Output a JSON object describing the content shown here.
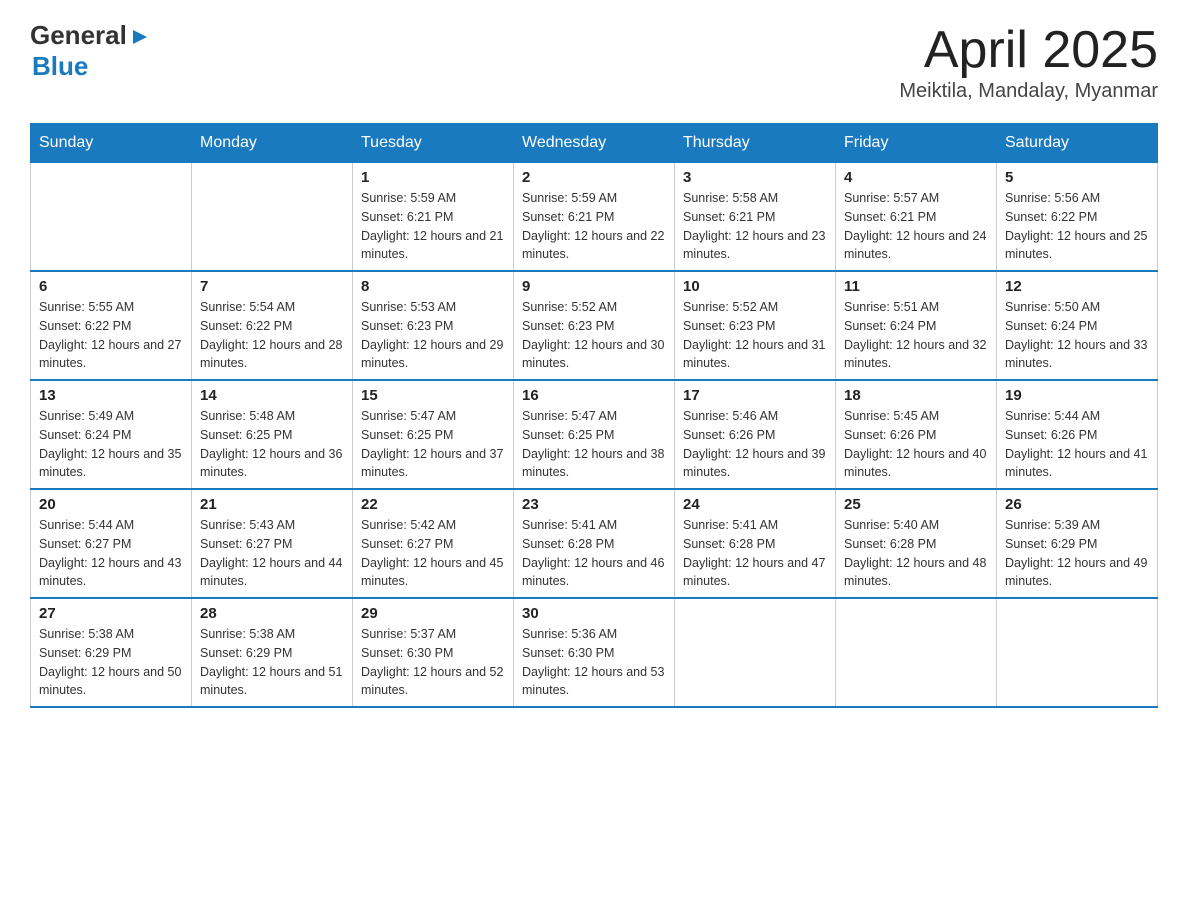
{
  "header": {
    "logo": {
      "text_general": "General",
      "text_blue": "Blue",
      "triangle": "▶"
    },
    "title": "April 2025",
    "subtitle": "Meiktila, Mandalay, Myanmar"
  },
  "calendar": {
    "headers": [
      "Sunday",
      "Monday",
      "Tuesday",
      "Wednesday",
      "Thursday",
      "Friday",
      "Saturday"
    ],
    "weeks": [
      [
        {
          "day": "",
          "sunrise": "",
          "sunset": "",
          "daylight": ""
        },
        {
          "day": "",
          "sunrise": "",
          "sunset": "",
          "daylight": ""
        },
        {
          "day": "1",
          "sunrise": "Sunrise: 5:59 AM",
          "sunset": "Sunset: 6:21 PM",
          "daylight": "Daylight: 12 hours and 21 minutes."
        },
        {
          "day": "2",
          "sunrise": "Sunrise: 5:59 AM",
          "sunset": "Sunset: 6:21 PM",
          "daylight": "Daylight: 12 hours and 22 minutes."
        },
        {
          "day": "3",
          "sunrise": "Sunrise: 5:58 AM",
          "sunset": "Sunset: 6:21 PM",
          "daylight": "Daylight: 12 hours and 23 minutes."
        },
        {
          "day": "4",
          "sunrise": "Sunrise: 5:57 AM",
          "sunset": "Sunset: 6:21 PM",
          "daylight": "Daylight: 12 hours and 24 minutes."
        },
        {
          "day": "5",
          "sunrise": "Sunrise: 5:56 AM",
          "sunset": "Sunset: 6:22 PM",
          "daylight": "Daylight: 12 hours and 25 minutes."
        }
      ],
      [
        {
          "day": "6",
          "sunrise": "Sunrise: 5:55 AM",
          "sunset": "Sunset: 6:22 PM",
          "daylight": "Daylight: 12 hours and 27 minutes."
        },
        {
          "day": "7",
          "sunrise": "Sunrise: 5:54 AM",
          "sunset": "Sunset: 6:22 PM",
          "daylight": "Daylight: 12 hours and 28 minutes."
        },
        {
          "day": "8",
          "sunrise": "Sunrise: 5:53 AM",
          "sunset": "Sunset: 6:23 PM",
          "daylight": "Daylight: 12 hours and 29 minutes."
        },
        {
          "day": "9",
          "sunrise": "Sunrise: 5:52 AM",
          "sunset": "Sunset: 6:23 PM",
          "daylight": "Daylight: 12 hours and 30 minutes."
        },
        {
          "day": "10",
          "sunrise": "Sunrise: 5:52 AM",
          "sunset": "Sunset: 6:23 PM",
          "daylight": "Daylight: 12 hours and 31 minutes."
        },
        {
          "day": "11",
          "sunrise": "Sunrise: 5:51 AM",
          "sunset": "Sunset: 6:24 PM",
          "daylight": "Daylight: 12 hours and 32 minutes."
        },
        {
          "day": "12",
          "sunrise": "Sunrise: 5:50 AM",
          "sunset": "Sunset: 6:24 PM",
          "daylight": "Daylight: 12 hours and 33 minutes."
        }
      ],
      [
        {
          "day": "13",
          "sunrise": "Sunrise: 5:49 AM",
          "sunset": "Sunset: 6:24 PM",
          "daylight": "Daylight: 12 hours and 35 minutes."
        },
        {
          "day": "14",
          "sunrise": "Sunrise: 5:48 AM",
          "sunset": "Sunset: 6:25 PM",
          "daylight": "Daylight: 12 hours and 36 minutes."
        },
        {
          "day": "15",
          "sunrise": "Sunrise: 5:47 AM",
          "sunset": "Sunset: 6:25 PM",
          "daylight": "Daylight: 12 hours and 37 minutes."
        },
        {
          "day": "16",
          "sunrise": "Sunrise: 5:47 AM",
          "sunset": "Sunset: 6:25 PM",
          "daylight": "Daylight: 12 hours and 38 minutes."
        },
        {
          "day": "17",
          "sunrise": "Sunrise: 5:46 AM",
          "sunset": "Sunset: 6:26 PM",
          "daylight": "Daylight: 12 hours and 39 minutes."
        },
        {
          "day": "18",
          "sunrise": "Sunrise: 5:45 AM",
          "sunset": "Sunset: 6:26 PM",
          "daylight": "Daylight: 12 hours and 40 minutes."
        },
        {
          "day": "19",
          "sunrise": "Sunrise: 5:44 AM",
          "sunset": "Sunset: 6:26 PM",
          "daylight": "Daylight: 12 hours and 41 minutes."
        }
      ],
      [
        {
          "day": "20",
          "sunrise": "Sunrise: 5:44 AM",
          "sunset": "Sunset: 6:27 PM",
          "daylight": "Daylight: 12 hours and 43 minutes."
        },
        {
          "day": "21",
          "sunrise": "Sunrise: 5:43 AM",
          "sunset": "Sunset: 6:27 PM",
          "daylight": "Daylight: 12 hours and 44 minutes."
        },
        {
          "day": "22",
          "sunrise": "Sunrise: 5:42 AM",
          "sunset": "Sunset: 6:27 PM",
          "daylight": "Daylight: 12 hours and 45 minutes."
        },
        {
          "day": "23",
          "sunrise": "Sunrise: 5:41 AM",
          "sunset": "Sunset: 6:28 PM",
          "daylight": "Daylight: 12 hours and 46 minutes."
        },
        {
          "day": "24",
          "sunrise": "Sunrise: 5:41 AM",
          "sunset": "Sunset: 6:28 PM",
          "daylight": "Daylight: 12 hours and 47 minutes."
        },
        {
          "day": "25",
          "sunrise": "Sunrise: 5:40 AM",
          "sunset": "Sunset: 6:28 PM",
          "daylight": "Daylight: 12 hours and 48 minutes."
        },
        {
          "day": "26",
          "sunrise": "Sunrise: 5:39 AM",
          "sunset": "Sunset: 6:29 PM",
          "daylight": "Daylight: 12 hours and 49 minutes."
        }
      ],
      [
        {
          "day": "27",
          "sunrise": "Sunrise: 5:38 AM",
          "sunset": "Sunset: 6:29 PM",
          "daylight": "Daylight: 12 hours and 50 minutes."
        },
        {
          "day": "28",
          "sunrise": "Sunrise: 5:38 AM",
          "sunset": "Sunset: 6:29 PM",
          "daylight": "Daylight: 12 hours and 51 minutes."
        },
        {
          "day": "29",
          "sunrise": "Sunrise: 5:37 AM",
          "sunset": "Sunset: 6:30 PM",
          "daylight": "Daylight: 12 hours and 52 minutes."
        },
        {
          "day": "30",
          "sunrise": "Sunrise: 5:36 AM",
          "sunset": "Sunset: 6:30 PM",
          "daylight": "Daylight: 12 hours and 53 minutes."
        },
        {
          "day": "",
          "sunrise": "",
          "sunset": "",
          "daylight": ""
        },
        {
          "day": "",
          "sunrise": "",
          "sunset": "",
          "daylight": ""
        },
        {
          "day": "",
          "sunrise": "",
          "sunset": "",
          "daylight": ""
        }
      ]
    ]
  }
}
